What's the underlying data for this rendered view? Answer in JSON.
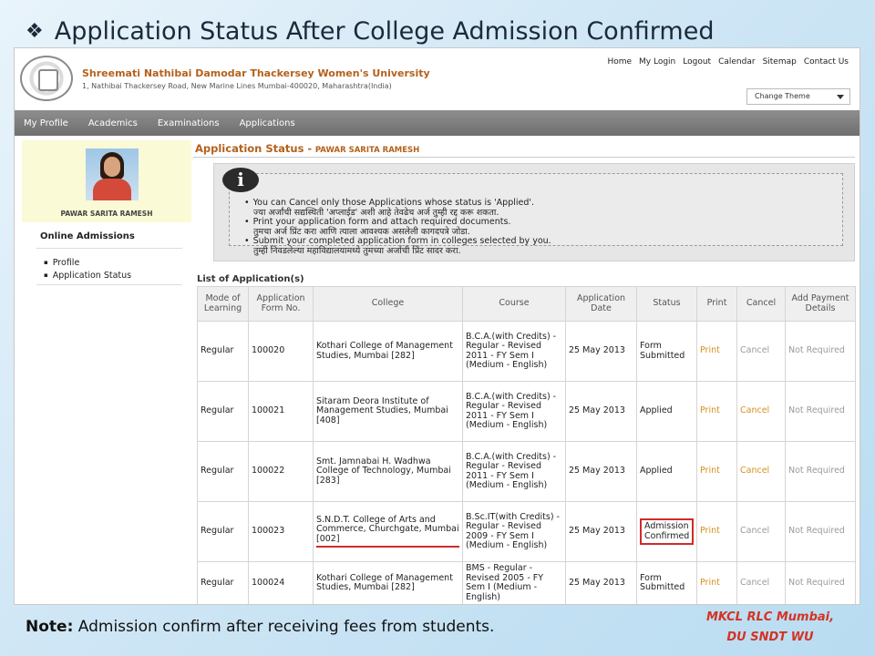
{
  "slide": {
    "title": "Application Status After College Admission Confirmed",
    "note_label": "Note:",
    "note_text": "Admission confirm after receiving fees from students.",
    "credit_line1": "MKCL RLC Mumbai,",
    "credit_line2": "DU SNDT WU"
  },
  "header": {
    "university_name": "Shreemati Nathibai Damodar Thackersey Women's University",
    "address": "1, Nathibai Thackersey Road, New Marine Lines Mumbai-400020, Maharashtra(India)",
    "top_links": [
      "Home",
      "My Login",
      "Logout",
      "Calendar",
      "Sitemap",
      "Contact Us"
    ],
    "theme_select": "Change Theme"
  },
  "nav": {
    "items": [
      "My Profile",
      "Academics",
      "Examinations",
      "Applications"
    ]
  },
  "sidebar": {
    "user_name": "PAWAR SARITA RAMESH",
    "heading": "Online Admissions",
    "links": [
      "Profile",
      "Application Status"
    ]
  },
  "main": {
    "title": "Application Status -",
    "title_name": "PAWAR SARITA RAMESH",
    "info": [
      {
        "en": "You can Cancel only those Applications whose status is 'Applied'.",
        "mr": "ज्या अर्जांची सद्यस्थिती 'अप्लाईड' अशी आहे तेवढेच अर्ज तुम्ही रद्द करू शकता."
      },
      {
        "en": "Print your application form and attach required documents.",
        "mr": "तुमचा अर्ज प्रिंट करा आणि त्याला आवश्यक असलेली कागदपत्रे जोडा."
      },
      {
        "en": "Submit your completed application form in colleges selected by you.",
        "mr": "तुम्ही निवडलेल्या महाविद्यालयामध्ये तुमच्या अर्जाची प्रिंट सादर करा."
      }
    ],
    "list_title": "List of Application(s)",
    "columns": [
      "Mode of Learning",
      "Application Form No.",
      "College",
      "Course",
      "Application Date",
      "Status",
      "Print",
      "Cancel",
      "Add Payment Details"
    ],
    "rows": [
      {
        "mode": "Regular",
        "form_no": "100020",
        "college": "Kothari College of Management Studies, Mumbai [282]",
        "course": "B.C.A.(with Credits) - Regular - Revised 2011 - FY Sem I (Medium - English)",
        "date": "25 May 2013",
        "status": "Form Submitted",
        "print": "Print",
        "cancel": "Cancel",
        "payment": "Not Required"
      },
      {
        "mode": "Regular",
        "form_no": "100021",
        "college": "Sitaram Deora Institute of Management Studies, Mumbai [408]",
        "course": "B.C.A.(with Credits) - Regular - Revised 2011 - FY Sem I (Medium - English)",
        "date": "25 May 2013",
        "status": "Applied",
        "print": "Print",
        "cancel": "Cancel",
        "payment": "Not Required"
      },
      {
        "mode": "Regular",
        "form_no": "100022",
        "college": "Smt. Jamnabai H. Wadhwa College of Technology, Mumbai [283]",
        "course": "B.C.A.(with Credits) - Regular - Revised 2011 - FY Sem I (Medium - English)",
        "date": "25 May 2013",
        "status": "Applied",
        "print": "Print",
        "cancel": "Cancel",
        "payment": "Not Required"
      },
      {
        "mode": "Regular",
        "form_no": "100023",
        "college": "S.N.D.T. College of Arts and Commerce, Churchgate, Mumbai [002]",
        "course": "B.Sc.IT(with Credits) - Regular - Revised 2009 - FY Sem I (Medium - English)",
        "date": "25 May 2013",
        "status": "Admission Confirmed",
        "print": "Print",
        "cancel": "Cancel",
        "payment": "Not Required"
      },
      {
        "mode": "Regular",
        "form_no": "100024",
        "college": "Kothari College of Management Studies, Mumbai [282]",
        "course": "BMS - Regular - Revised 2005 - FY Sem I (Medium - English)",
        "date": "25 May 2013",
        "status": "Form Submitted",
        "print": "Print",
        "cancel": "Cancel",
        "payment": "Not Required"
      }
    ]
  },
  "colors": {
    "accent_orange": "#b5611c",
    "link_orange": "#d8901e",
    "highlight_red": "#d12a2a",
    "nav_gray": "#7f7f7f"
  }
}
